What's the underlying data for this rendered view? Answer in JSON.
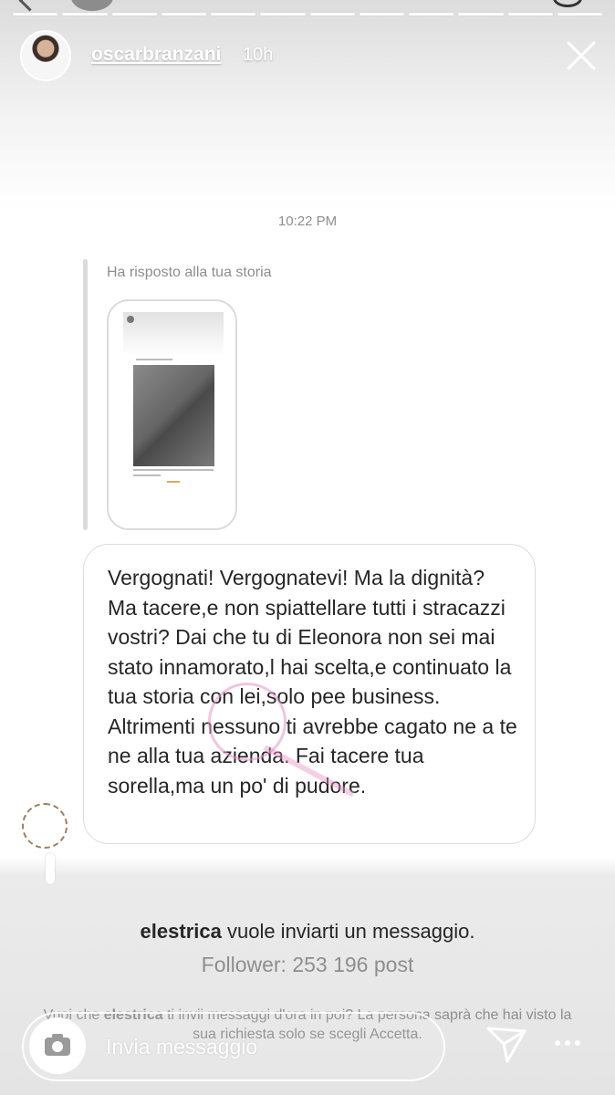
{
  "story": {
    "username": "oscarbranzani",
    "time_ago": "10h",
    "segments": 12
  },
  "dm": {
    "timestamp": "10:22 PM",
    "reply_label": "Ha risposto alla tua storia",
    "message": "Vergognati! Vergognatevi! Ma la dignità? Ma tacere,e non spiattellare tutti i stracazzi vostri? Dai che tu di Eleonora non sei mai stato innamorato,l hai scelta,e continuato la tua storia con lei,solo pee business. Altrimenti nessuno ti avrebbe cagato ne a te ne alla tua azienda. Fai tacere tua sorella,ma un po' di pudore."
  },
  "request": {
    "username": "elestrica",
    "title_suffix": "vuole inviarti un messaggio.",
    "followers_line": "Follower: 253 196 post",
    "desc_prefix": "Vuoi che",
    "desc_suffix": "ti invii messaggi d'ora in poi? La persona saprà che hai visto la sua richiesta solo se scegli Accetta."
  },
  "input": {
    "placeholder": "Invia messaggio"
  },
  "icons": {
    "close": "close-icon",
    "camera": "camera-icon",
    "send": "send-icon",
    "more": "more-icon"
  }
}
